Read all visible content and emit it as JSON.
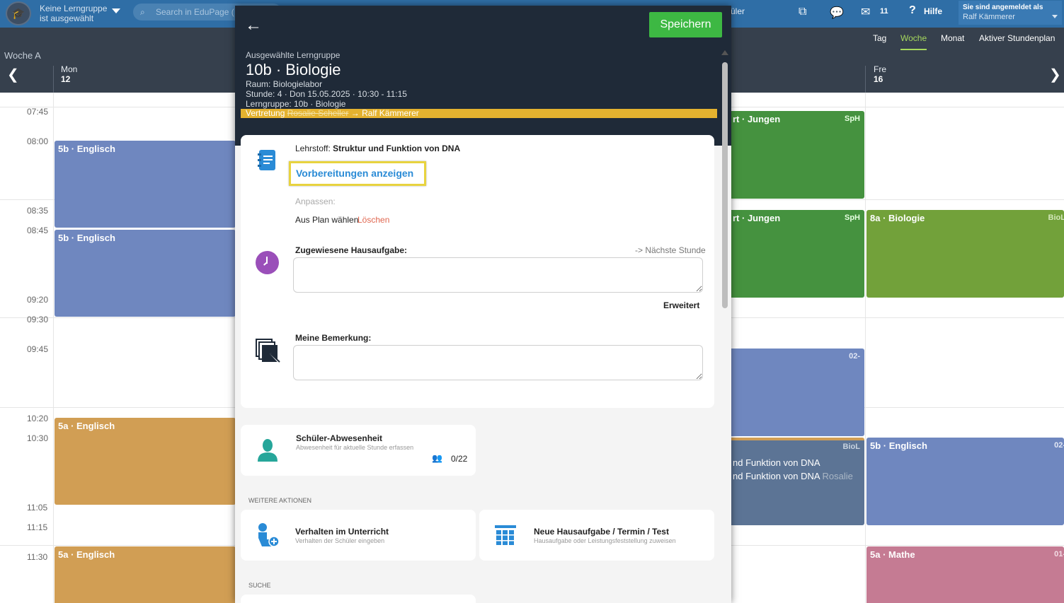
{
  "topbar": {
    "group_line1": "Keine Lerngruppe",
    "group_line2": "ist ausgewählt",
    "search_placeholder": "Search in EduPage (",
    "schueler_label": "üler",
    "mail_count": "11",
    "help_label": "Hilfe",
    "login_line1": "Sie sind angemeldet als",
    "login_line2": "Ralf Kämmerer"
  },
  "calendar": {
    "week_label": "Woche A",
    "view_tabs": [
      "Tag",
      "Woche",
      "Monat",
      "Aktiver Stundenplan"
    ],
    "active_view": "Woche",
    "days": [
      {
        "name": "Mon",
        "num": "12"
      },
      {
        "name": "Fre",
        "num": "16"
      }
    ],
    "times": [
      "07:45",
      "08:00",
      "08:35",
      "08:45",
      "09:20",
      "09:30",
      "09:45",
      "10:20",
      "10:30",
      "11:05",
      "11:15",
      "11:30"
    ],
    "lessons": {
      "mon1": {
        "title": "5b · Englisch"
      },
      "mon2": {
        "title": "5b · Englisch"
      },
      "mon3": {
        "title": "5a · Englisch"
      },
      "mon4": {
        "title": "5a · Englisch"
      },
      "thu1": {
        "title": "rt · Jungen",
        "room": "SpH"
      },
      "thu2": {
        "title": "rt · Jungen",
        "room": "SpH"
      },
      "thu3": {
        "room": "02-"
      },
      "thu4": {
        "room": "BioL",
        "line1": "nd Funktion von DNA",
        "line2": "nd Funktion von DNA",
        "line2_muted": "Rosalie"
      },
      "fri1": {
        "title": "8a · Biologie",
        "room": "BioL"
      },
      "fri2": {
        "title": "5b · Englisch",
        "room": "02-"
      },
      "fri3": {
        "title": "5a · Mathe",
        "room": "01-"
      }
    },
    "colors": {
      "blue": "#6f87bf",
      "orange": "#d19e54",
      "green": "#45923f",
      "olive": "#72a13a",
      "slate": "#5c7495",
      "pink": "#c57b93"
    }
  },
  "modal": {
    "save_label": "Speichern",
    "selected_label": "Ausgewählte Lerngruppe",
    "title": "10b · Biologie",
    "raum": "Raum: Biologielabor",
    "stunde": "Stunde: 4 · Don 15.05.2025 · 10:30 - 11:15",
    "lerngruppe": "Lerngruppe: 10b · Biologie",
    "vertretung_prefix": "Vertretung",
    "vertretung_old": "Rosalie Scheller",
    "vertretung_new": "→ Ralf Kämmerer",
    "lehrstoff_label": "Lehrstoff:",
    "lehrstoff_value": "Struktur und Funktion von DNA",
    "vorbereitungen_label": "Vorbereitungen anzeigen",
    "anpassen_label": "Anpassen:",
    "aus_plan_label": "Aus Plan wählen",
    "loeschen_label": "Löschen",
    "hausaufgabe_label": "Zugewiesene Hausaufgabe:",
    "naechste_stunde_label": "-> Nächste Stunde",
    "erweitert_label": "Erweitert",
    "bemerkung_label": "Meine Bemerkung:",
    "abwesenheit_title": "Schüler-Abwesenheit",
    "abwesenheit_sub": "Abwesenheit für aktuelle Stunde erfassen",
    "abwesenheit_count": "0/22",
    "weitere_aktionen": "WEITERE AKTIONEN",
    "verhalten_title": "Verhalten im Unterricht",
    "verhalten_sub": "Verhalten der Schüler eingeben",
    "neue_ha_title": "Neue Hausaufgabe / Termin / Test",
    "neue_ha_sub": "Hausaufgabe oder Leistungsfeststellung zuweisen",
    "suche": "SUCHE"
  }
}
